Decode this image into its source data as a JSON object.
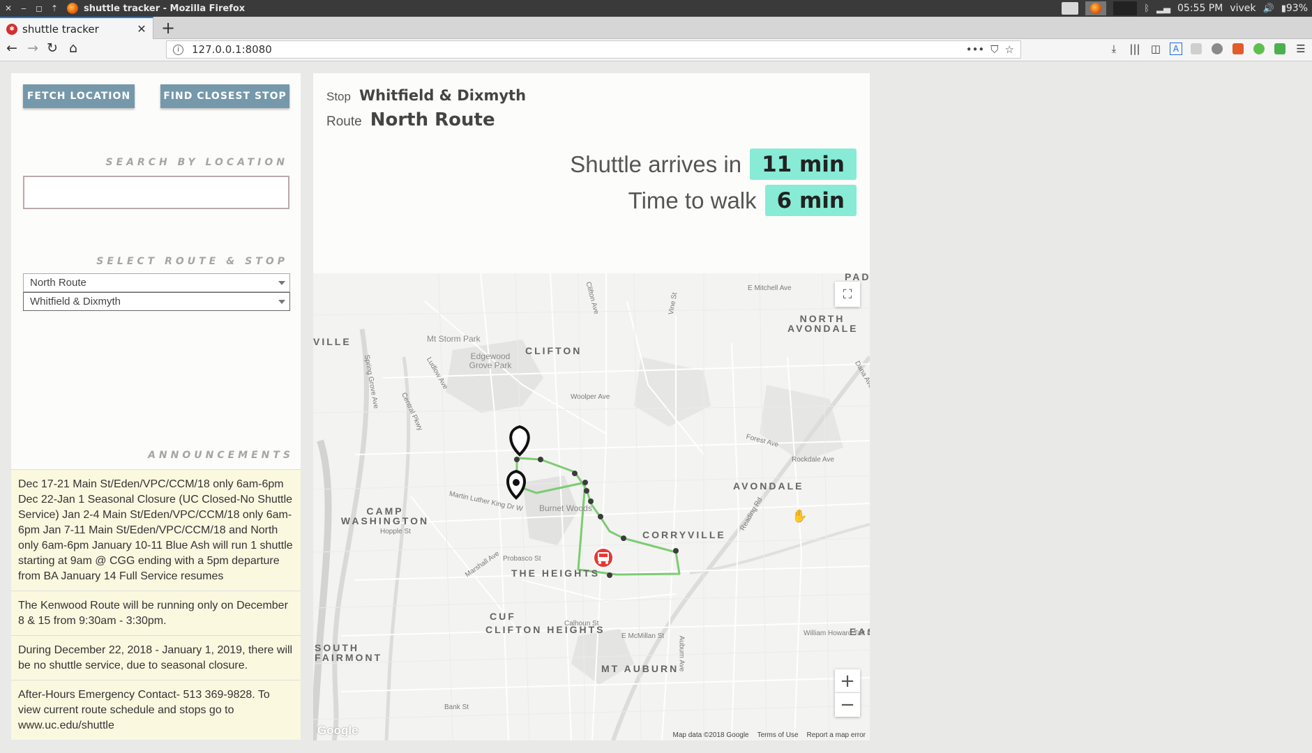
{
  "os_bar": {
    "window_title": "shuttle tracker - Mozilla Firefox",
    "time": "05:55 PM",
    "user": "vivek",
    "battery": "93%"
  },
  "browser": {
    "tab_title": "shuttle tracker",
    "url": "127.0.0.1:8080"
  },
  "sidebar": {
    "fetch_button": "FETCH LOCATION",
    "closest_button": "FIND CLOSEST STOP",
    "search_label": "SEARCH BY LOCATION",
    "search_value": "",
    "route_stop_label": "SELECT ROUTE & STOP",
    "route_selected": "North Route",
    "stop_selected": "Whitfield & Dixmyth",
    "announcements_label": "ANNOUNCEMENTS",
    "announcements": [
      "Dec 17-21 Main St/Eden/VPC/CCM/18 only 6am-6pm Dec 22-Jan 1 Seasonal Closure (UC Closed-No Shuttle Service) Jan 2-4 Main St/Eden/VPC/CCM/18 only 6am-6pm Jan 7-11 Main St/Eden/VPC/CCM/18 and North only 6am-6pm January 10-11 Blue Ash will run 1 shuttle starting at 9am @ CGG ending with a 5pm departure from BA January 14 Full Service resumes",
      "The Kenwood Route will be running only on December 8 & 15 from 9:30am - 3:30pm.",
      "During December 22, 2018 - January 1, 2019, there will be no shuttle service, due to seasonal closure.",
      "After-Hours Emergency Contact- 513 369-9828. To view current route schedule and stops go to www.uc.edu/shuttle"
    ]
  },
  "info": {
    "stop_key": "Stop",
    "stop_value": "Whitfield & Dixmyth",
    "route_key": "Route",
    "route_value": "North Route",
    "arrives_label": "Shuttle arrives in",
    "arrives_value": "11 min",
    "walk_label": "Time to walk",
    "walk_value": "6 min"
  },
  "map": {
    "neighborhoods": [
      "CLIFTON",
      "NORTH AVONDALE",
      "AVONDALE",
      "CORRYVILLE",
      "CAMP WASHINGTON",
      "THE HEIGHTS",
      "CUF",
      "CLIFTON HEIGHTS",
      "MT AUBURN",
      "SOUTH FAIRMONT",
      "VILLE",
      "PAD",
      "EAS"
    ],
    "parks": [
      "Mt Storm Park",
      "Edgewood Grove Park",
      "Burnet Woods"
    ],
    "streets": [
      "Clifton Ave",
      "Vine St",
      "E Mitchell Ave",
      "Ludlow Ave",
      "Spring Grove Ave",
      "Central Pkwy",
      "Woolper Ave",
      "Forest Ave",
      "Rockdale Ave",
      "Martin Luther King Dr W",
      "Hopple St",
      "Probasco St",
      "Marshall Ave",
      "Reading Rd",
      "Calhoun St",
      "E McMillan St",
      "William Howard Taft Rd",
      "Auburn Ave",
      "Bank St",
      "Dana Ave"
    ],
    "footer": [
      "Map data ©2018 Google",
      "Terms of Use",
      "Report a map error"
    ],
    "logo": "Google",
    "route_color": "#7ccc72",
    "bus_color": "#e53935"
  }
}
